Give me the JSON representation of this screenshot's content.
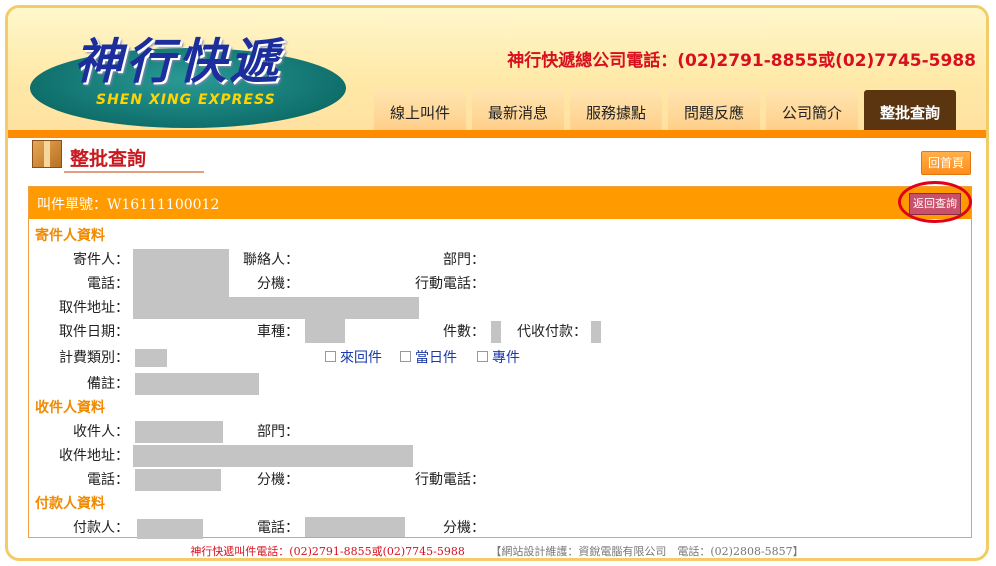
{
  "header": {
    "logo_title": "神行快遞",
    "logo_subtitle": "SHEN XING EXPRESS",
    "phone": "神行快遞總公司電話：(02)2791-8855或(02)7745-5988"
  },
  "nav": {
    "tabs": [
      "線上叫件",
      "最新消息",
      "服務據點",
      "問題反應",
      "公司簡介",
      "整批查詢"
    ],
    "active": "整批查詢"
  },
  "page": {
    "title": "整批查詢",
    "home_label": "回首頁"
  },
  "panel": {
    "order_label": "叫件單號：W16111100012",
    "back_label": "返回查詢",
    "sender_section": "寄件人資料",
    "receiver_section": "收件人資料",
    "payer_section": "付款人資料",
    "labels": {
      "sender": "寄件人：",
      "contact": "聯絡人：",
      "dept": "部門：",
      "phone": "電話：",
      "ext": "分機：",
      "mobile": "行動電話：",
      "pickup_addr": "取件地址：",
      "pickup_date": "取件日期：",
      "vehicle": "車種：",
      "count": "件數：",
      "cod": "代收付款：",
      "fee_type": "計費類別：",
      "note": "備註：",
      "receiver": "收件人：",
      "receiver_dept": "部門：",
      "receiver_addr": "收件地址：",
      "receiver_phone": "電話：",
      "receiver_ext": "分機：",
      "receiver_mobile": "行動電話：",
      "payer": "付款人：",
      "payer_phone": "電話：",
      "payer_ext": "分機："
    },
    "options": [
      "來回件",
      "當日件",
      "專件"
    ]
  },
  "footer": {
    "company_phone": "神行快遞叫件電話：(02)2791-8855或(02)7745-5988",
    "maintainer": "【網站設計維護：資銳電腦有限公司　電話：(02)2808-5857】"
  }
}
